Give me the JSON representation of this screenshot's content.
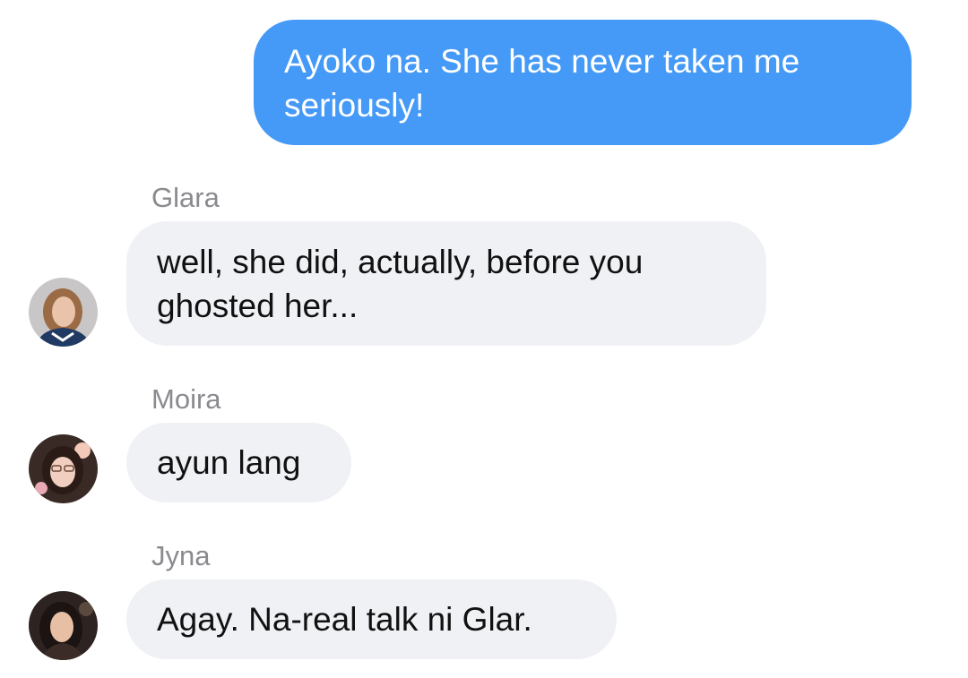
{
  "messages": [
    {
      "direction": "outgoing",
      "text": "Ayoko na. She has never taken me seriously!"
    },
    {
      "direction": "incoming",
      "sender": "Glara",
      "avatar": "glara-avatar",
      "text": "well, she did, actually, before you ghosted her..."
    },
    {
      "direction": "incoming",
      "sender": "Moira",
      "avatar": "moira-avatar",
      "text": "ayun lang"
    },
    {
      "direction": "incoming",
      "sender": "Jyna",
      "avatar": "jyna-avatar",
      "text": "Agay. Na-real talk ni Glar."
    }
  ],
  "colors": {
    "outgoing_bubble": "#4599f7",
    "incoming_bubble": "#f0f1f5",
    "sender_name": "#8a8a8f"
  }
}
